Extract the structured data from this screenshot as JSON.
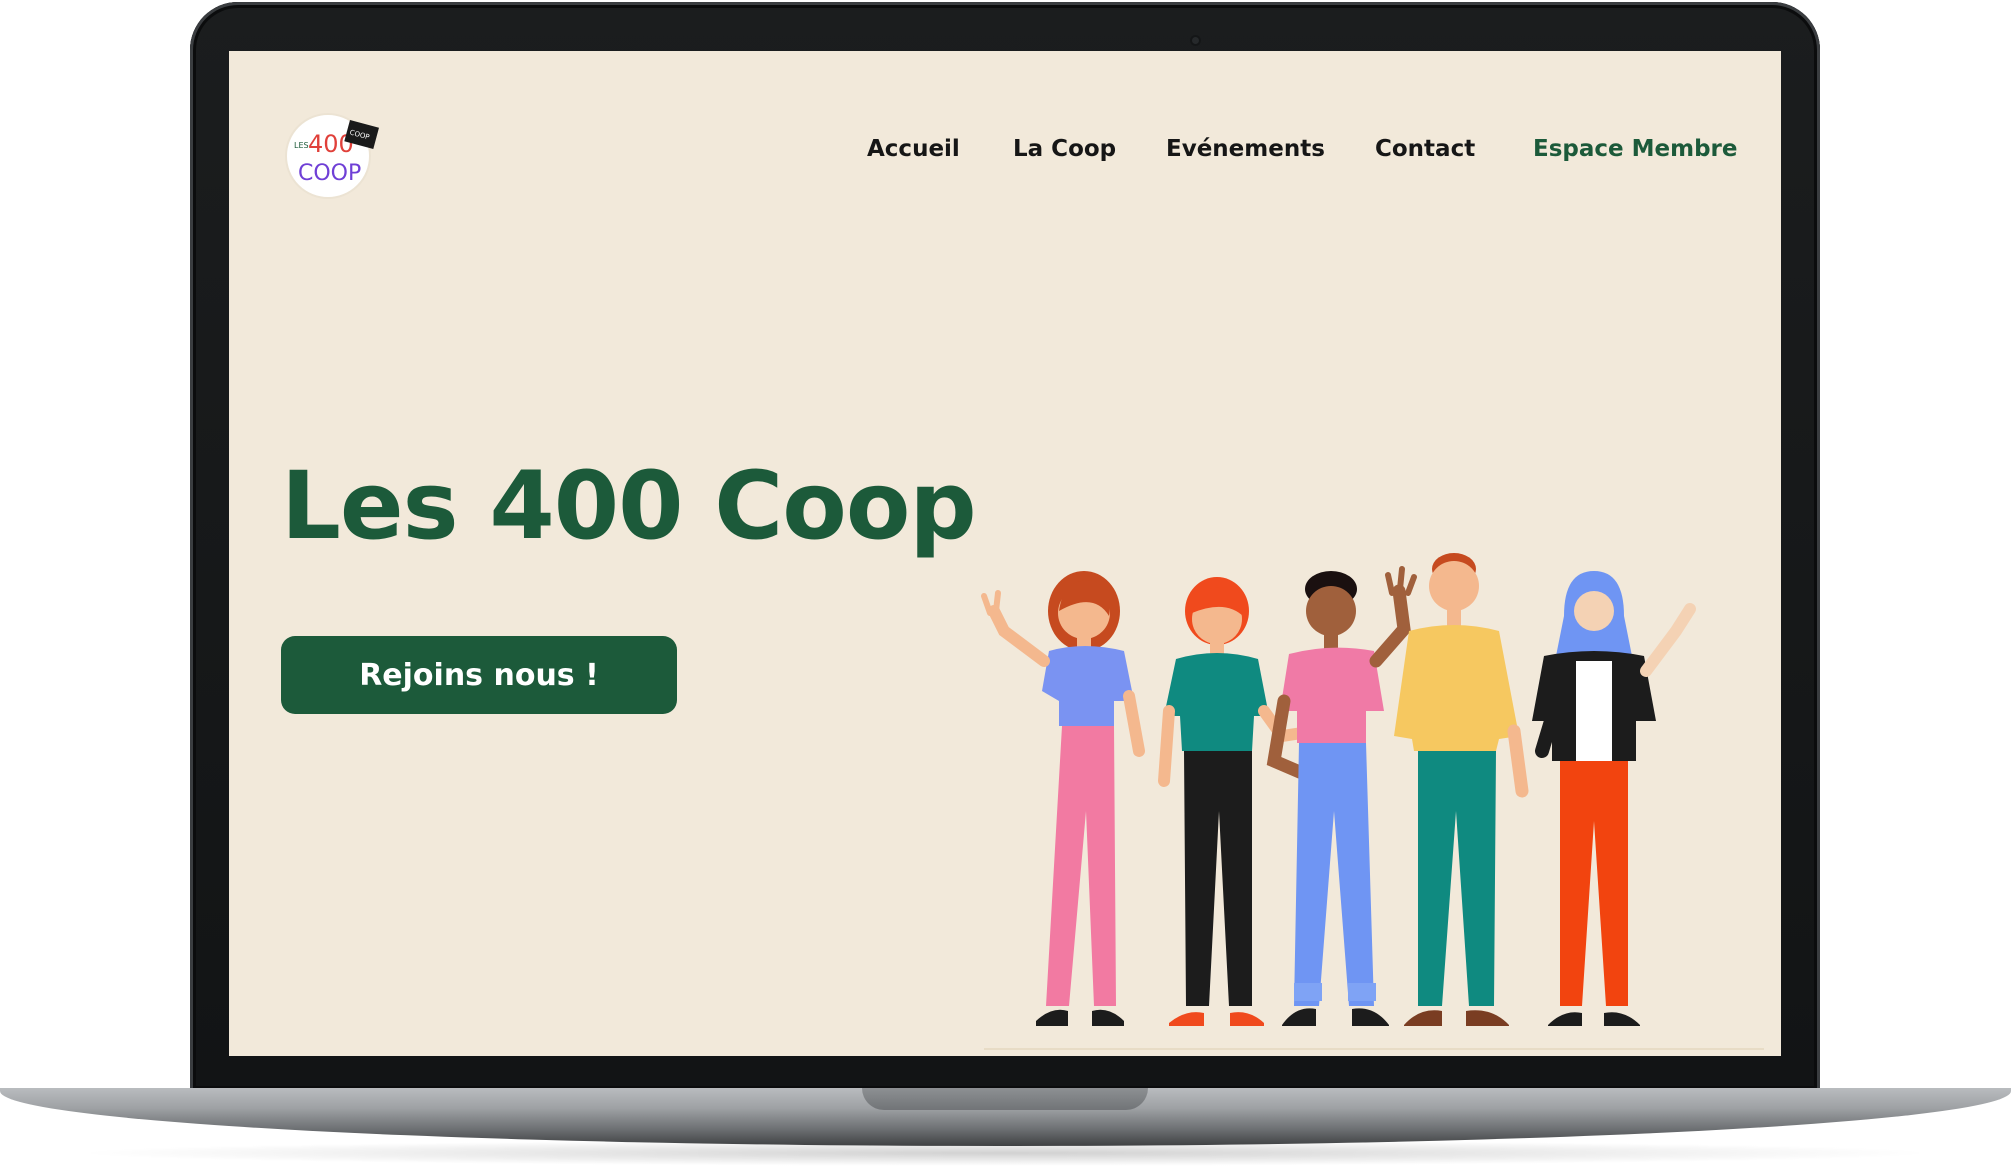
{
  "site": {
    "logo": {
      "small_text": "LES",
      "number": "400",
      "word": "COOP",
      "badge_text": "COOP"
    },
    "nav": {
      "items": [
        {
          "label": "Accueil"
        },
        {
          "label": "La Coop"
        },
        {
          "label": "Evénements"
        },
        {
          "label": "Contact"
        },
        {
          "label": "Espace Membre"
        }
      ]
    },
    "hero": {
      "title": "Les 400 Coop",
      "cta_label": "Rejoins nous !"
    }
  },
  "colors": {
    "brand_green": "#1c5a3a",
    "page_background": "#f2e9da",
    "nav_text": "#161616"
  },
  "illustration": {
    "people": [
      {
        "name": "person-peace-sign",
        "top": "#7a93f2",
        "pants": "#f27aa2",
        "hair": "#c64a1f"
      },
      {
        "name": "person-teal-shirt",
        "top": "#0f8a80",
        "pants": "#1c1c1c",
        "hair": "#f04a1d"
      },
      {
        "name": "person-waving",
        "top": "#f07aa6",
        "pants": "#6f95f3",
        "hair": "#1a1010"
      },
      {
        "name": "person-yellow-shirt",
        "top": "#f6c860",
        "pants": "#0f8a80",
        "hair": "#c64a1f"
      },
      {
        "name": "person-hijab",
        "top": "#1c1c1c",
        "pants": "#f2440f",
        "hair": "#6f95f3"
      }
    ]
  }
}
